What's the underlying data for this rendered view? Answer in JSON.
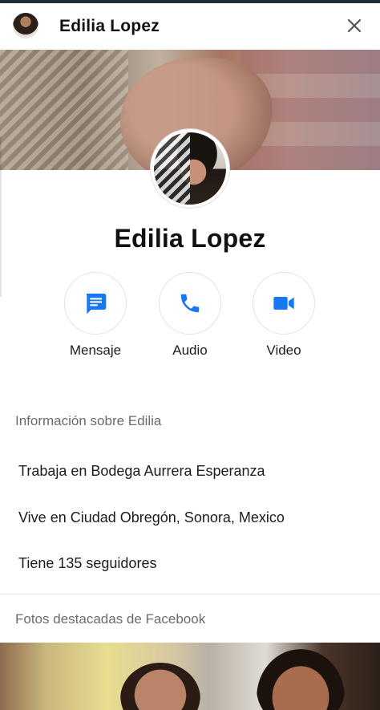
{
  "header": {
    "title": "Edilia Lopez"
  },
  "profile": {
    "name": "Edilia Lopez"
  },
  "actions": [
    {
      "label": "Mensaje",
      "icon": "message-icon"
    },
    {
      "label": "Audio",
      "icon": "phone-icon"
    },
    {
      "label": "Video",
      "icon": "video-camera-icon"
    }
  ],
  "info": {
    "title": "Información sobre Edilia",
    "rows": [
      "Trabaja en Bodega Aurrera Esperanza",
      "Vive en Ciudad Obregón, Sonora, Mexico",
      "Tiene 135 seguidores"
    ]
  },
  "photos": {
    "title": "Fotos destacadas de Facebook"
  },
  "colors": {
    "accent": "#1877F2",
    "text": "#111111",
    "secondary_text": "#6b6b6b"
  }
}
